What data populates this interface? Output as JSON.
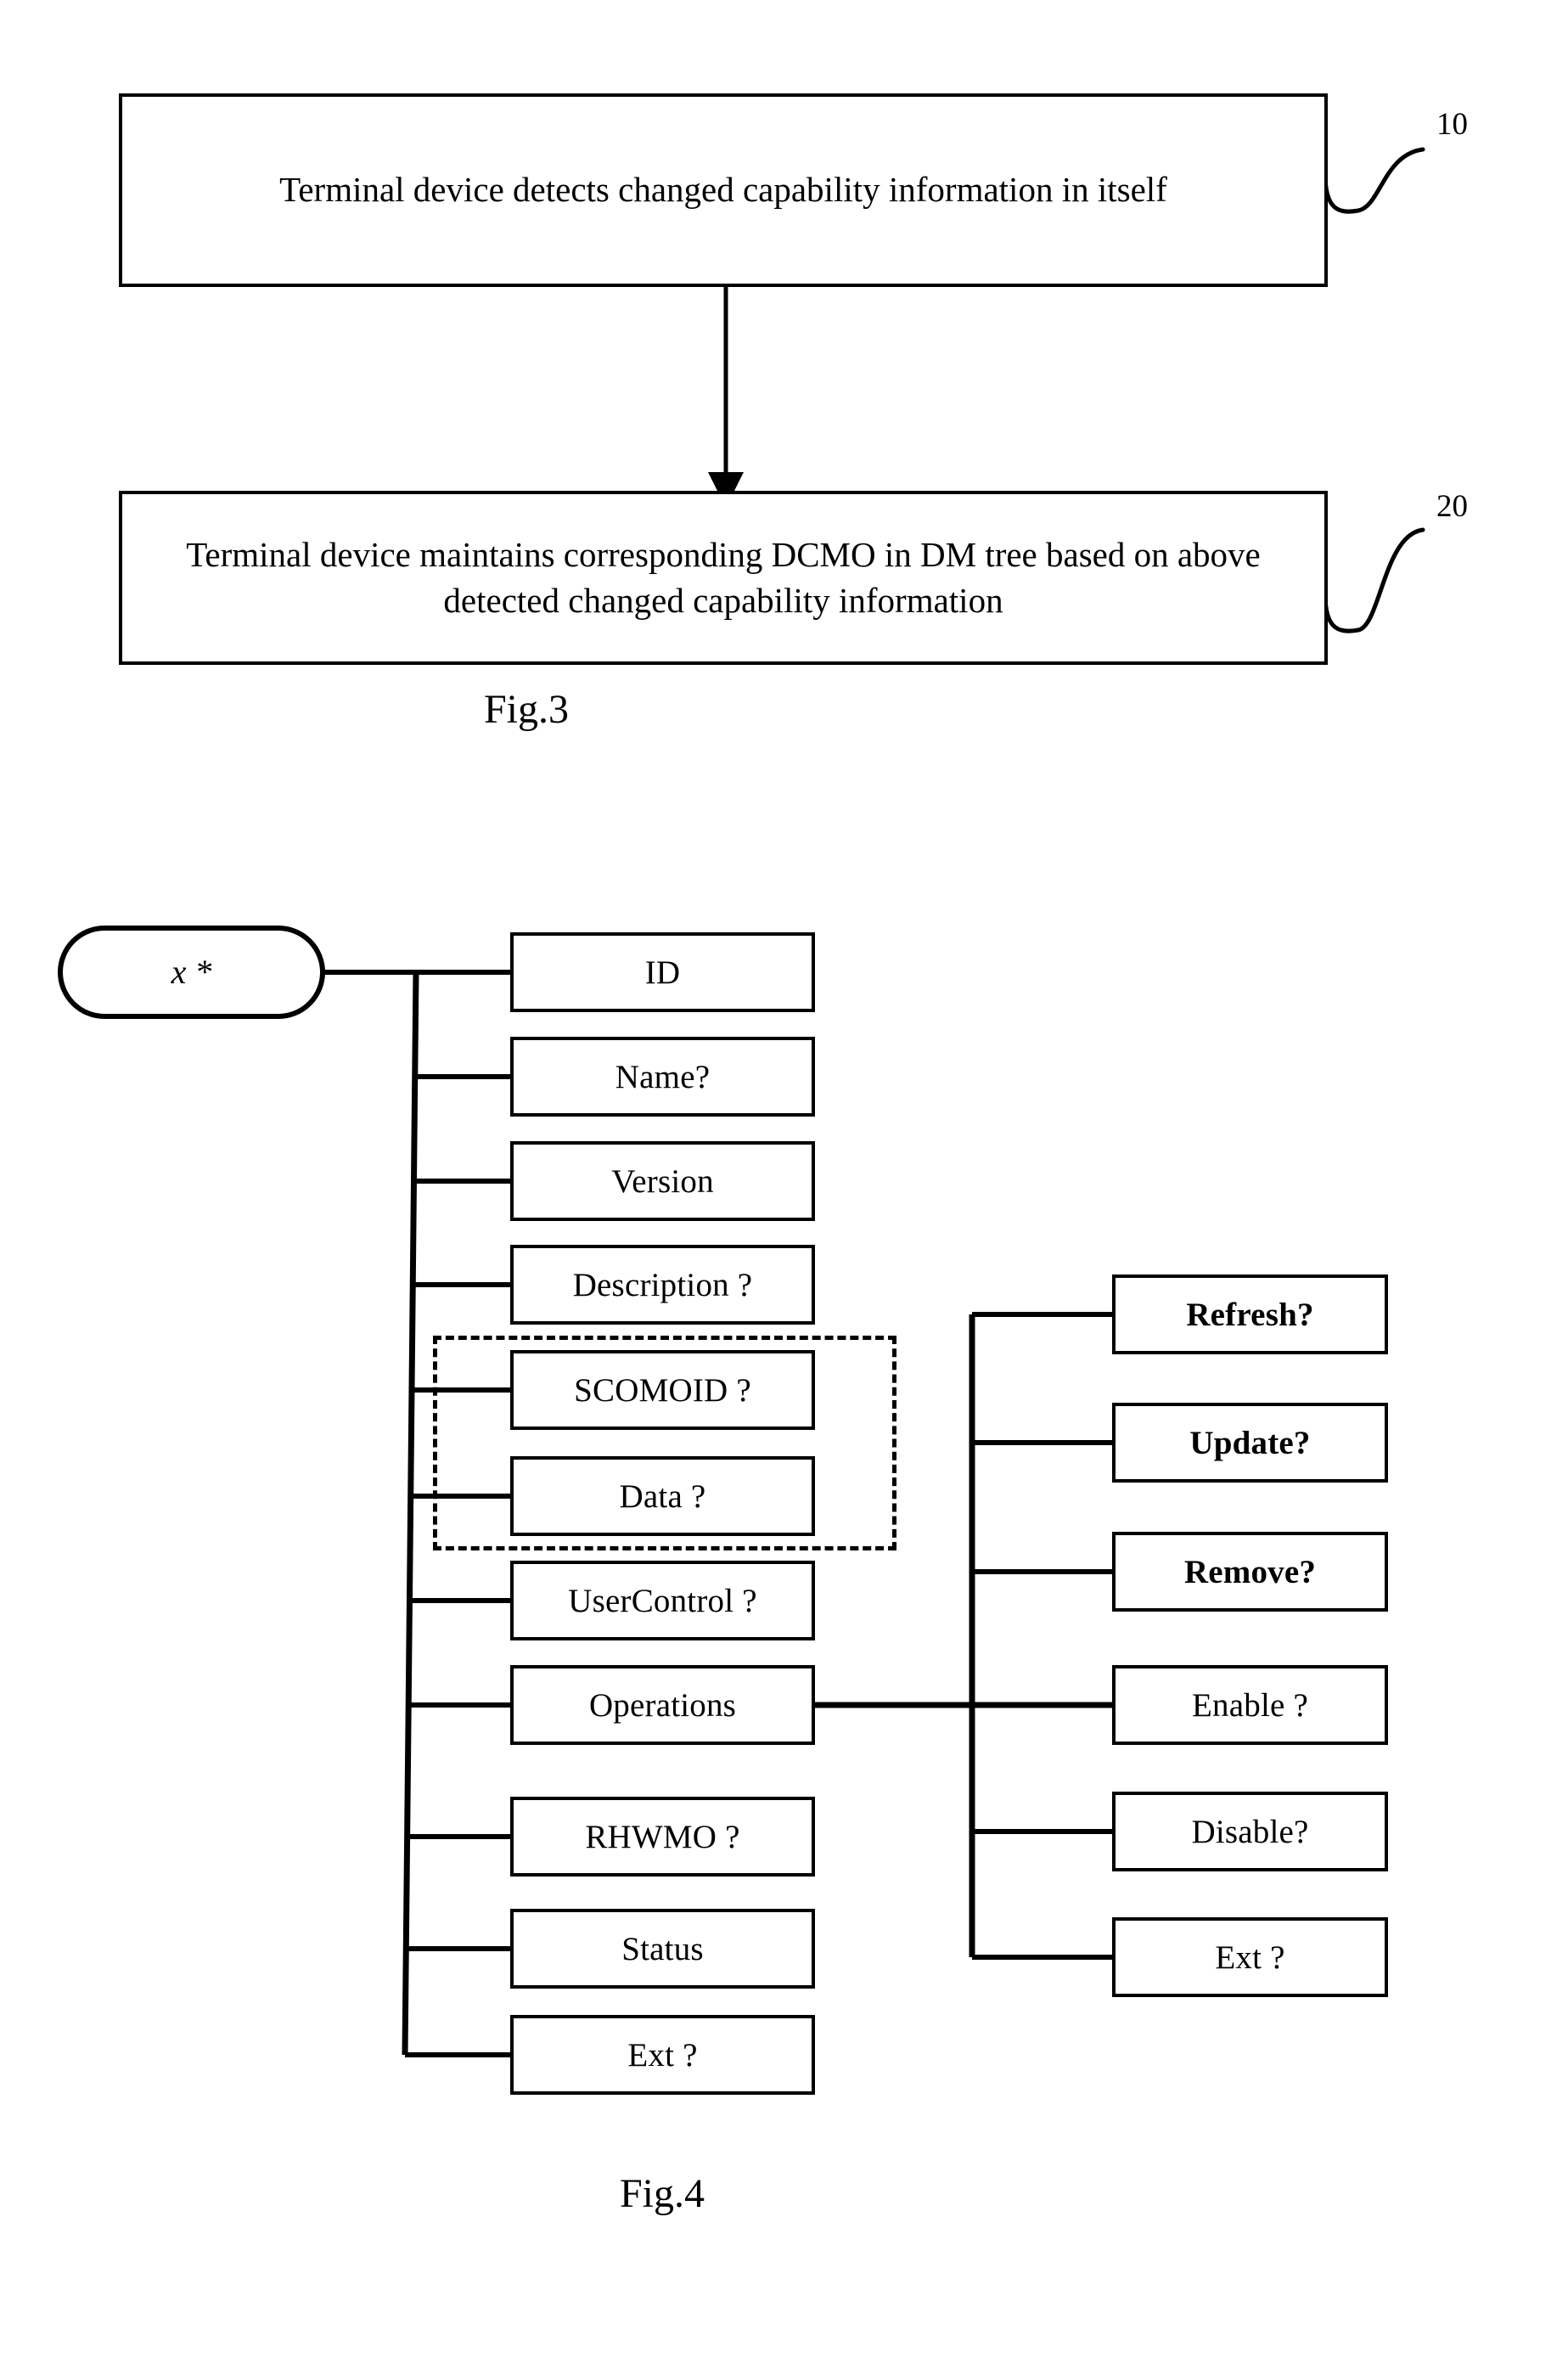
{
  "document": {
    "kind": "patent-figure-sheet",
    "figures": [
      "Fig.3",
      "Fig.4"
    ]
  },
  "fig3": {
    "caption": "Fig.3",
    "steps": [
      {
        "id": "step-10",
        "ref": "10",
        "text": "Terminal device detects changed capability information in itself"
      },
      {
        "id": "step-20",
        "ref": "20",
        "text": "Terminal device maintains corresponding DCMO in DM tree based on above detected changed capability information"
      }
    ]
  },
  "fig4": {
    "caption": "Fig.4",
    "root": {
      "label": "x *"
    },
    "children": [
      {
        "label": "ID",
        "bold": false
      },
      {
        "label": "Name?",
        "bold": false
      },
      {
        "label": "Version",
        "bold": false
      },
      {
        "label": "Description ?",
        "bold": false
      },
      {
        "label": "SCOMOID ?",
        "bold": false
      },
      {
        "label": "Data ?",
        "bold": false
      },
      {
        "label": "UserControl ?",
        "bold": false
      },
      {
        "label": "Operations",
        "bold": false
      },
      {
        "label": "RHWMO ?",
        "bold": false
      },
      {
        "label": "Status",
        "bold": false
      },
      {
        "label": "Ext ?",
        "bold": false
      }
    ],
    "operations_children": [
      {
        "label": "Refresh?",
        "bold": true
      },
      {
        "label": "Update?",
        "bold": true
      },
      {
        "label": "Remove?",
        "bold": true
      },
      {
        "label": "Enable ?",
        "bold": false
      },
      {
        "label": "Disable?",
        "bold": false
      },
      {
        "label": "Ext ?",
        "bold": false
      }
    ],
    "grouped_nodes": [
      "SCOMOID ?",
      "Data ?"
    ],
    "group_style": "dashed-rectangle"
  },
  "colors": {
    "ink": "#000000",
    "paper": "#ffffff"
  }
}
